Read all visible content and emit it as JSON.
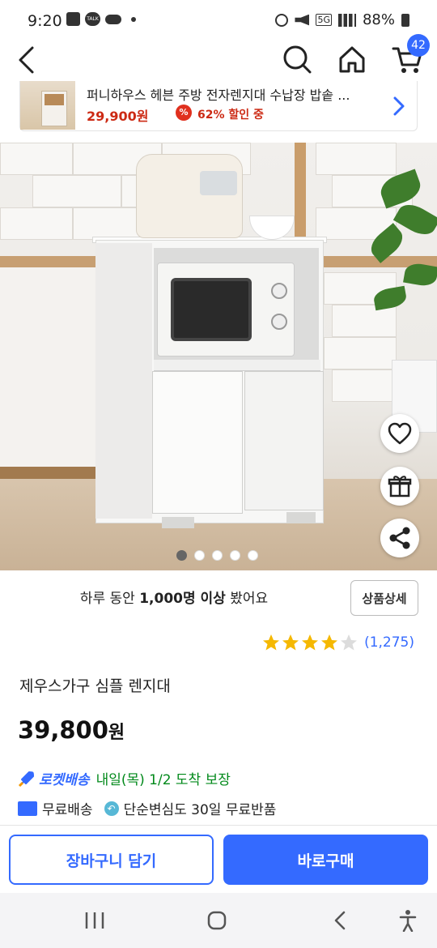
{
  "status_bar": {
    "time": "9:20",
    "talk_label": "TALK",
    "network": "5G",
    "battery": "88%"
  },
  "header": {
    "cart_count": "42"
  },
  "banner": {
    "title": "퍼니하우스 헤븐 주방 전자렌지대 수납장 밥솥 ...",
    "price": "29,900원",
    "discount_icon": "%",
    "discount": "62% 할인 중"
  },
  "gallery": {
    "pages": 5,
    "active_index": 0
  },
  "views": {
    "prefix": "하루 동안",
    "count": "1,000명 이상",
    "suffix": "봤어요"
  },
  "detail_button": "상품상세",
  "rating": {
    "stars": 4,
    "max": 5,
    "count": "(1,275)"
  },
  "product": {
    "name": "제우스가구 심플 렌지대",
    "price": "39,800",
    "currency": "원"
  },
  "delivery": {
    "brand": "로켓배송",
    "eta": "내일(목) 1/2 도착 보장",
    "free_shipping": "무료배송",
    "free_return": "단순변심도 30일 무료반품"
  },
  "actions": {
    "cart": "장바구니 담기",
    "buy": "바로구매"
  },
  "colors": {
    "accent": "#346aff",
    "sale": "#cc2a14",
    "eta": "#00891a",
    "star": "#f5b800"
  }
}
